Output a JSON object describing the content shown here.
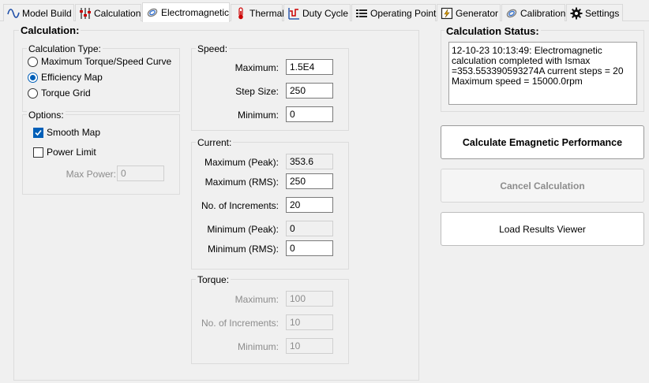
{
  "tabs": [
    {
      "label": "Model Build",
      "icon": "sine-wave-icon"
    },
    {
      "label": "Calculation",
      "icon": "sliders-icon"
    },
    {
      "label": "Electromagnetic",
      "icon": "coil-icon",
      "active": true
    },
    {
      "label": "Thermal",
      "icon": "thermometer-icon"
    },
    {
      "label": "Duty Cycle",
      "icon": "duty-cycle-icon"
    },
    {
      "label": "Operating Point",
      "icon": "list-icon"
    },
    {
      "label": "Generator",
      "icon": "generator-icon"
    },
    {
      "label": "Calibration",
      "icon": "calibration-icon"
    },
    {
      "label": "Settings",
      "icon": "gear-icon"
    }
  ],
  "calculation": {
    "title": "Calculation:",
    "type_group": {
      "title": "Calculation Type:",
      "options": [
        {
          "label": "Maximum Torque/Speed Curve",
          "selected": false
        },
        {
          "label": "Efficiency Map",
          "selected": true
        },
        {
          "label": "Torque Grid",
          "selected": false
        }
      ]
    },
    "options_group": {
      "title": "Options:",
      "smooth_map": {
        "label": "Smooth Map",
        "checked": true
      },
      "power_limit": {
        "label": "Power Limit",
        "checked": false
      },
      "max_power": {
        "label": "Max Power:",
        "value": "0"
      }
    },
    "speed": {
      "title": "Speed:",
      "maximum": {
        "label": "Maximum:",
        "value": "1.5E4"
      },
      "step_size": {
        "label": "Step Size:",
        "value": "250"
      },
      "minimum": {
        "label": "Minimum:",
        "value": "0"
      }
    },
    "current": {
      "title": "Current:",
      "max_peak": {
        "label": "Maximum (Peak):",
        "value": "353.6"
      },
      "max_rms": {
        "label": "Maximum (RMS):",
        "value": "250"
      },
      "increments": {
        "label": "No. of Increments:",
        "value": "20"
      },
      "min_peak": {
        "label": "Minimum (Peak):",
        "value": "0"
      },
      "min_rms": {
        "label": "Minimum (RMS):",
        "value": "0"
      }
    },
    "torque": {
      "title": "Torque:",
      "maximum": {
        "label": "Maximum:",
        "value": "100"
      },
      "increments": {
        "label": "No. of Increments:",
        "value": "10"
      },
      "minimum": {
        "label": "Minimum:",
        "value": "10"
      }
    }
  },
  "status": {
    "title": "Calculation Status:",
    "text": "12-10-23 10:13:49: Electromagnetic calculation completed with Ismax =353.553390593274A current steps = 20 Maximum speed = 15000.0rpm"
  },
  "buttons": {
    "calculate": "Calculate Emagnetic Performance",
    "cancel": "Cancel Calculation",
    "load": "Load Results Viewer"
  },
  "colors": {
    "accent": "#005fb8",
    "disabled_text": "#8c8c8c"
  }
}
